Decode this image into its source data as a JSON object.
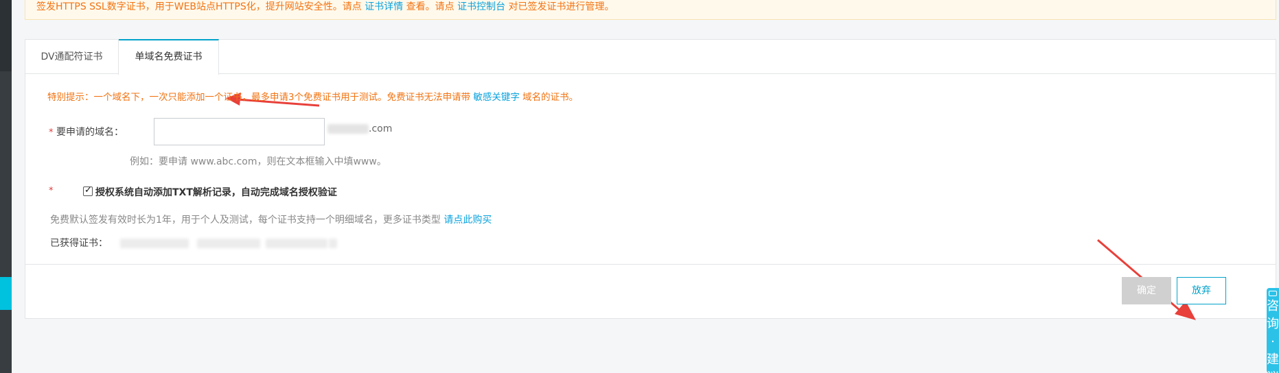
{
  "notice": {
    "prefix": "签发HTTPS SSL数字证书，用于WEB站点HTTPS化，提升网站安全性。请点 ",
    "link1": "证书详情",
    "mid": " 查看。请点 ",
    "link2": "证书控制台",
    "suffix": " 对已签发证书进行管理。"
  },
  "tabs": [
    {
      "label": "DV通配符证书"
    },
    {
      "label": "单域名免费证书"
    }
  ],
  "tip": {
    "text": "特别提示：一个域名下，一次只能添加一个证书，最多申请3个免费证书用于测试。免费证书无法申请带 ",
    "link": "敏感关键字",
    "suffix": " 域名的证书。"
  },
  "form": {
    "required_mark": "*",
    "domain_label": "要申请的域名：",
    "domain_value": "",
    "domain_suffix": ".com",
    "hint": "例如：要申请 www.abc.com，则在文本框输入中填www。",
    "auth_checkbox_label": "授权系统自动添加TXT解析记录，自动完成域名授权验证",
    "auth_checked": true,
    "desc": "免费默认签发有效时长为1年，用于个人及测试，每个证书支持一个明细域名，更多证书类型 ",
    "desc_link": "请点此购买",
    "obtained_label": "已获得证书："
  },
  "buttons": {
    "confirm": "确定",
    "cancel": "放弃"
  },
  "consult": {
    "label": "咨询·建议"
  },
  "colors": {
    "accent": "#00a2ca",
    "link": "#0aa2dc",
    "warning": "#f27311",
    "annotation_arrow": "#e8403a"
  }
}
